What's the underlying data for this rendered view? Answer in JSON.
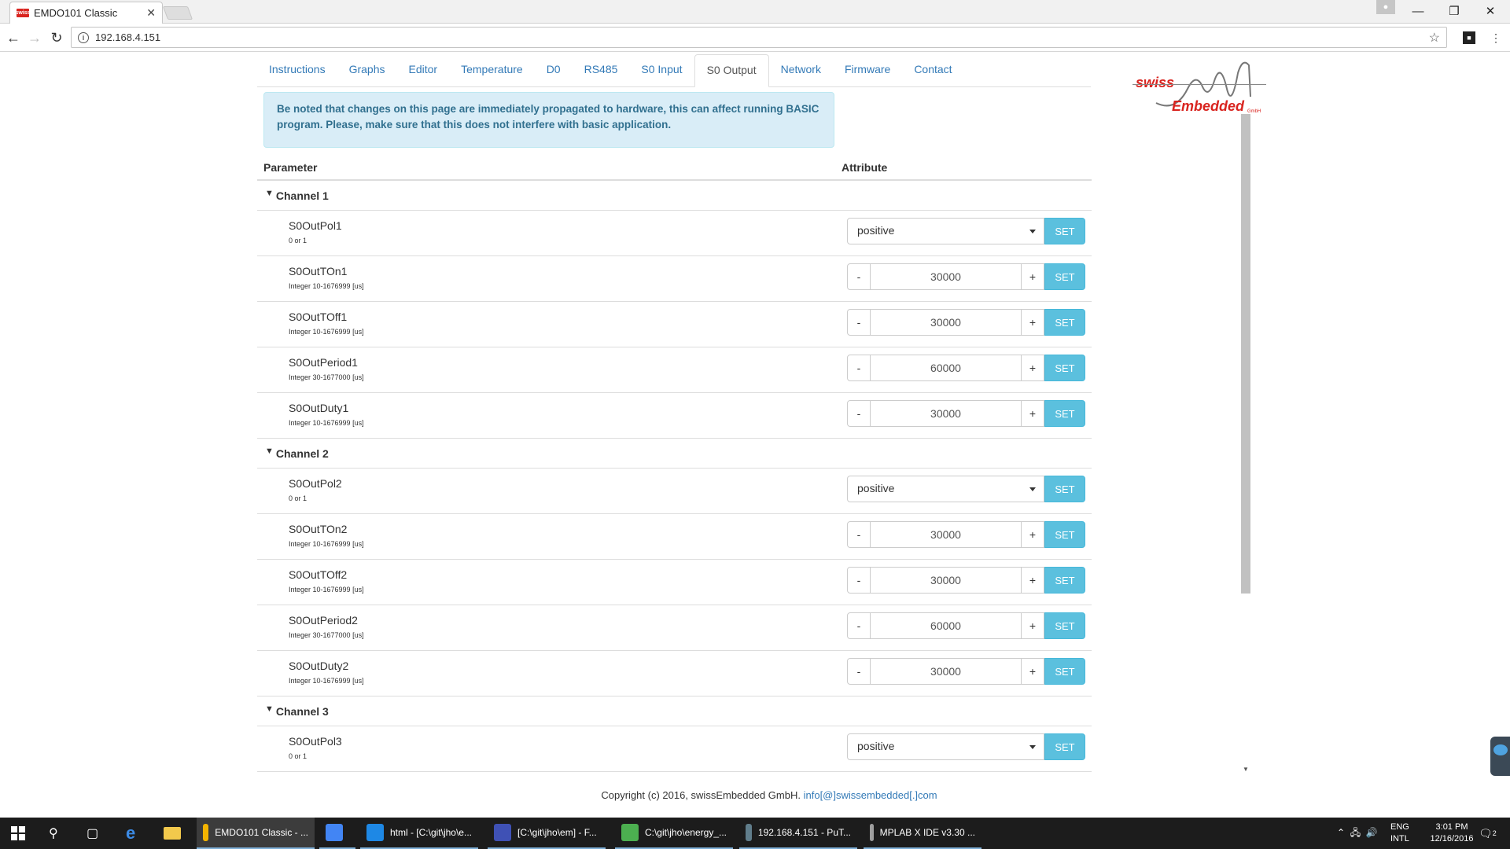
{
  "browser": {
    "tab_title": "EMDO101 Classic",
    "tab_favicon": "swiss",
    "tab_close": "✕",
    "url": "192.168.4.151",
    "window_controls": [
      "—",
      "❐",
      "✕"
    ]
  },
  "nav": {
    "tabs": [
      {
        "label": "Instructions"
      },
      {
        "label": "Graphs"
      },
      {
        "label": "Editor"
      },
      {
        "label": "Temperature"
      },
      {
        "label": "D0"
      },
      {
        "label": "RS485"
      },
      {
        "label": "S0 Input"
      },
      {
        "label": "S0 Output",
        "active": true
      },
      {
        "label": "Network"
      },
      {
        "label": "Firmware"
      },
      {
        "label": "Contact"
      }
    ]
  },
  "logo": {
    "line1": "swiss",
    "line2": "Embedded",
    "suffix": "GmbH"
  },
  "alert": {
    "text": "Be noted that changes on this page are immediately propagated to hardware, this can affect running BASIC program. Please, make sure that this does not interfere with basic application."
  },
  "table": {
    "header_parameter": "Parameter",
    "header_attribute": "Attribute",
    "set_label": "SET",
    "minus_label": "-",
    "plus_label": "+",
    "channels": [
      {
        "title": "Channel 1",
        "rows": [
          {
            "name": "S0OutPol1",
            "desc": "0 or 1",
            "type": "select",
            "value": "positive"
          },
          {
            "name": "S0OutTOn1",
            "desc": "Integer 10-1676999 [us]",
            "type": "stepper",
            "value": "30000"
          },
          {
            "name": "S0OutTOff1",
            "desc": "Integer 10-1676999 [us]",
            "type": "stepper",
            "value": "30000"
          },
          {
            "name": "S0OutPeriod1",
            "desc": "Integer 30-1677000 [us]",
            "type": "stepper",
            "value": "60000"
          },
          {
            "name": "S0OutDuty1",
            "desc": "Integer 10-1676999 [us]",
            "type": "stepper",
            "value": "30000"
          }
        ]
      },
      {
        "title": "Channel 2",
        "rows": [
          {
            "name": "S0OutPol2",
            "desc": "0 or 1",
            "type": "select",
            "value": "positive"
          },
          {
            "name": "S0OutTOn2",
            "desc": "Integer 10-1676999 [us]",
            "type": "stepper",
            "value": "30000"
          },
          {
            "name": "S0OutTOff2",
            "desc": "Integer 10-1676999 [us]",
            "type": "stepper",
            "value": "30000"
          },
          {
            "name": "S0OutPeriod2",
            "desc": "Integer 30-1677000 [us]",
            "type": "stepper",
            "value": "60000"
          },
          {
            "name": "S0OutDuty2",
            "desc": "Integer 10-1676999 [us]",
            "type": "stepper",
            "value": "30000"
          }
        ]
      },
      {
        "title": "Channel 3",
        "rows": [
          {
            "name": "S0OutPol3",
            "desc": "0 or 1",
            "type": "select",
            "value": "positive"
          }
        ]
      }
    ]
  },
  "footer": {
    "text": "Copyright (c) 2016, swissEmbedded GmbH.",
    "email": "info[@]swissembedded[.]com"
  },
  "taskbar": {
    "apps": [
      {
        "label": "EMDO101 Classic - ...",
        "icon": "chrome-canary-icon",
        "active": true,
        "color": "#f4b400"
      },
      {
        "label": "",
        "icon": "chrome-icon",
        "color": "#4285f4"
      },
      {
        "label": "html - [C:\\git\\jho\\e...",
        "icon": "webstorm-icon",
        "color": "#1e88e5"
      },
      {
        "label": "[C:\\git\\jho\\em] - F...",
        "icon": "ide-icon",
        "color": "#3f51b5"
      },
      {
        "label": "C:\\git\\jho\\energy_...",
        "icon": "notepad-icon",
        "color": "#4caf50"
      },
      {
        "label": "192.168.4.151 - PuT...",
        "icon": "putty-icon",
        "color": "#607d8b"
      },
      {
        "label": "MPLAB X IDE v3.30 ...",
        "icon": "mplab-icon",
        "color": "#9e9e9e"
      }
    ],
    "lang": "ENG",
    "lang2": "INTL",
    "time": "3:01 PM",
    "date": "12/16/2016",
    "notif_count": "2"
  }
}
